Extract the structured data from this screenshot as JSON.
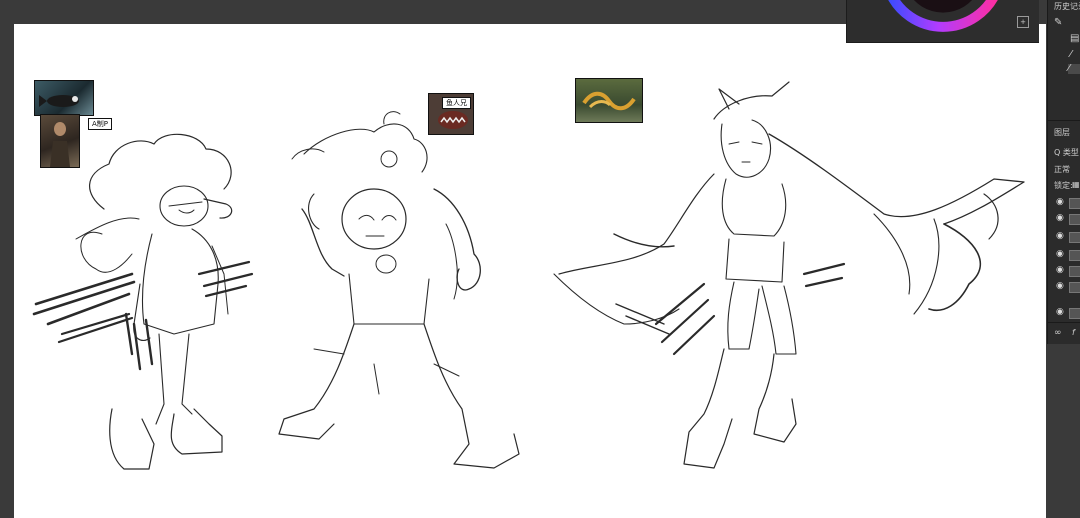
{
  "reference_images": {
    "ref_b_label": "A制P",
    "ref_c_label": "鱼人兄"
  },
  "history_panel": {
    "title": "历史记录"
  },
  "layers_panel": {
    "tab_label": "图层",
    "search_label": "Q 类型",
    "blend_mode": "正常",
    "lock_label": "锁定:"
  },
  "colors": {
    "workspace_bg": "#3a3a3a",
    "canvas_bg": "#ffffff",
    "panel_bg": "#2b2b2b",
    "stroke": "#2a2a2a"
  }
}
